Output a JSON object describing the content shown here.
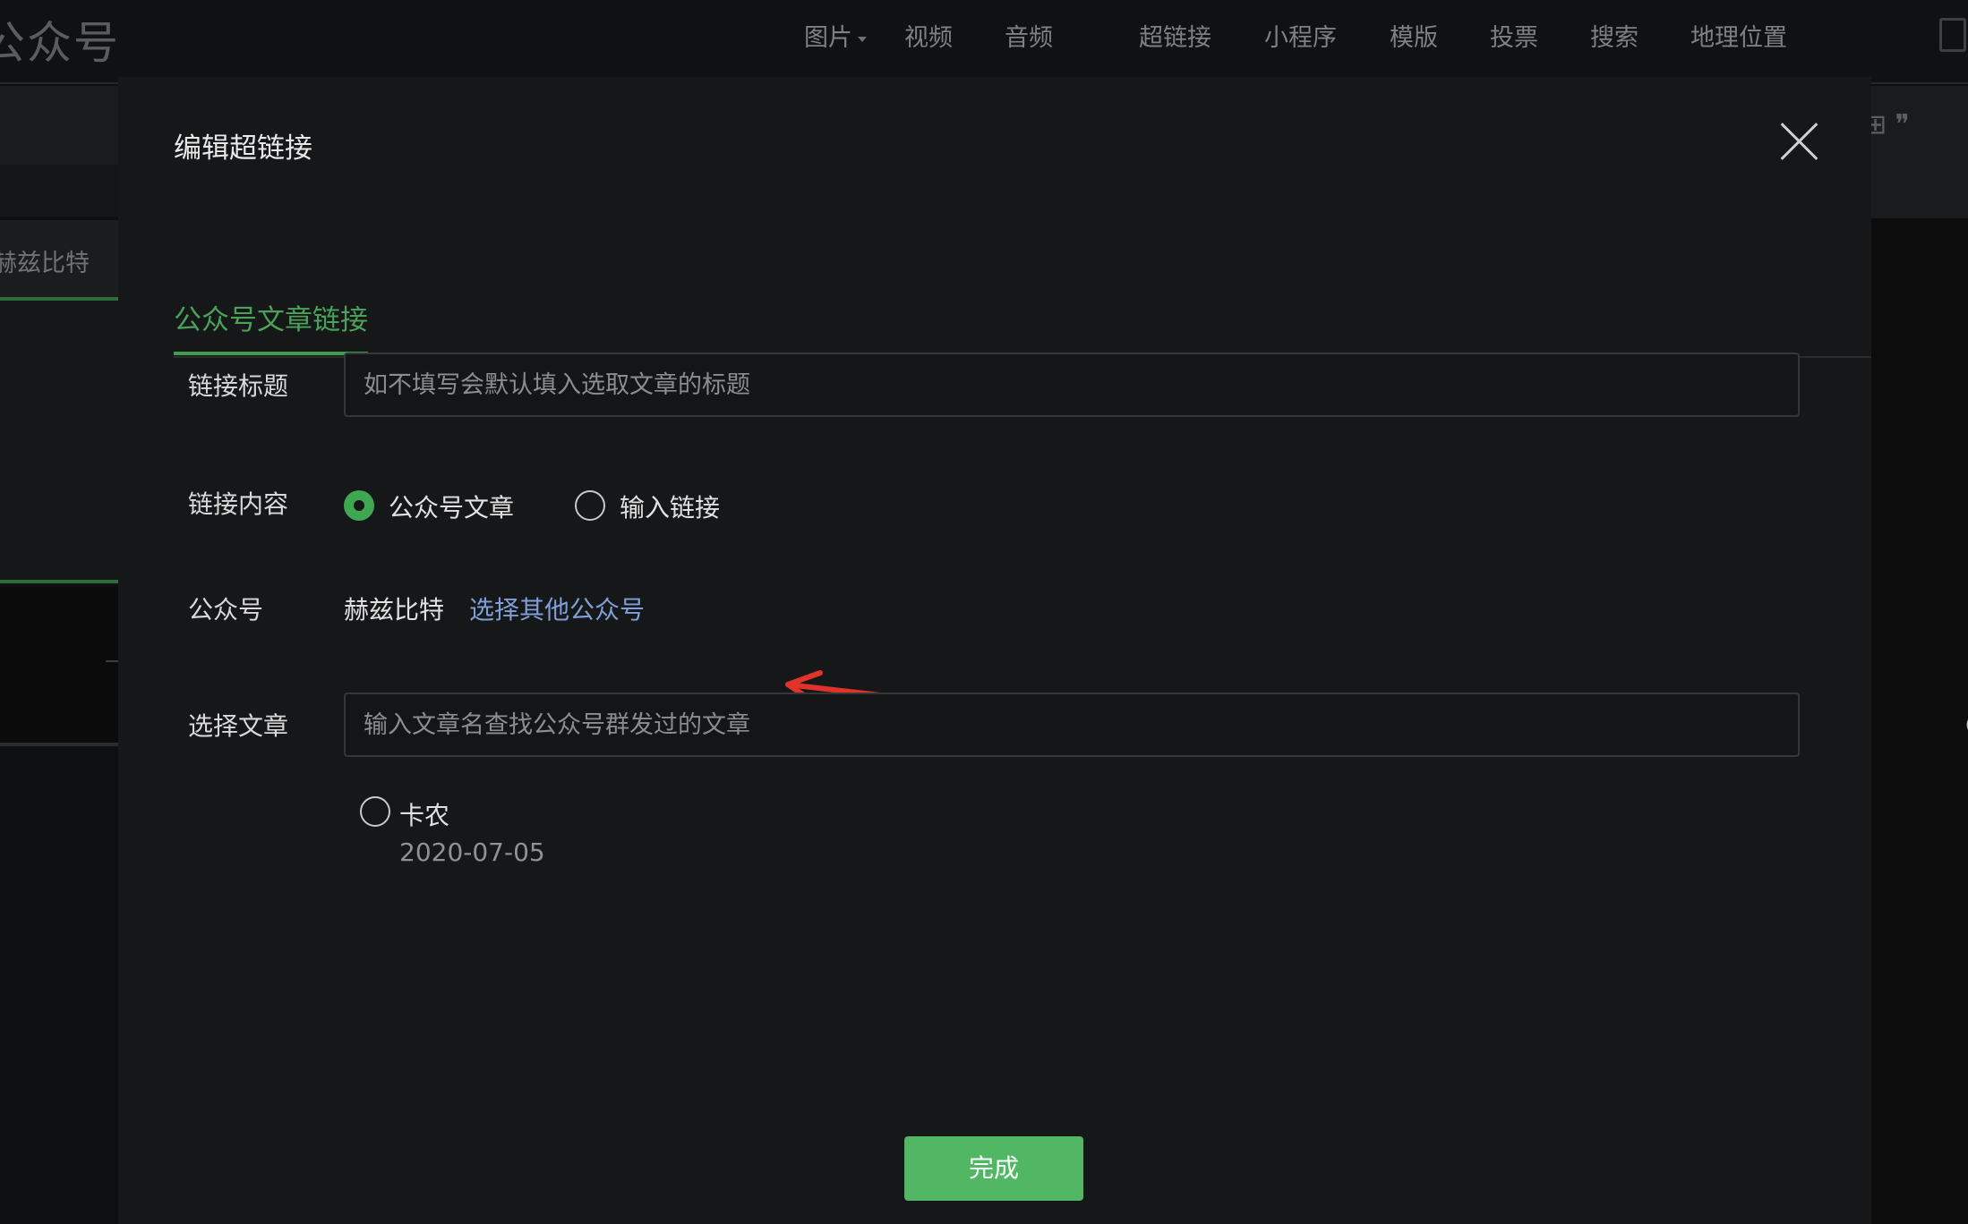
{
  "background": {
    "brand_text": "公众号",
    "toolbar_items": [
      "图片",
      "视频",
      "音频",
      "超链接",
      "小程序",
      "模版",
      "投票",
      "搜索",
      "地理位置"
    ],
    "side_tab_label": "赫兹比特",
    "right_icons_text": "⊞ ❞"
  },
  "modal": {
    "title": "编辑超链接",
    "tab_active": "公众号文章链接",
    "link_title": {
      "label": "链接标题",
      "placeholder": "如不填写会默认填入选取文章的标题",
      "value": ""
    },
    "link_content": {
      "label": "链接内容",
      "options": [
        {
          "label": "公众号文章",
          "checked": true
        },
        {
          "label": "输入链接",
          "checked": false
        }
      ]
    },
    "account": {
      "label": "公众号",
      "name": "赫兹比特",
      "switch_link": "选择其他公众号"
    },
    "select_article": {
      "label": "选择文章",
      "placeholder": "输入文章名查找公众号群发过的文章",
      "value": ""
    },
    "articles": [
      {
        "title": "卡农",
        "date": "2020-07-05",
        "selected": false
      }
    ],
    "done_label": "完成"
  },
  "icons": {
    "close": "close-icon",
    "search": "search-icon",
    "annotation": "red-arrow-icon"
  },
  "colors": {
    "accent_green": "#3fa652",
    "tab_green": "#4aa158",
    "link_blue": "#7f9fd6",
    "annotation_red": "#e0342a",
    "modal_bg": "#161719"
  }
}
